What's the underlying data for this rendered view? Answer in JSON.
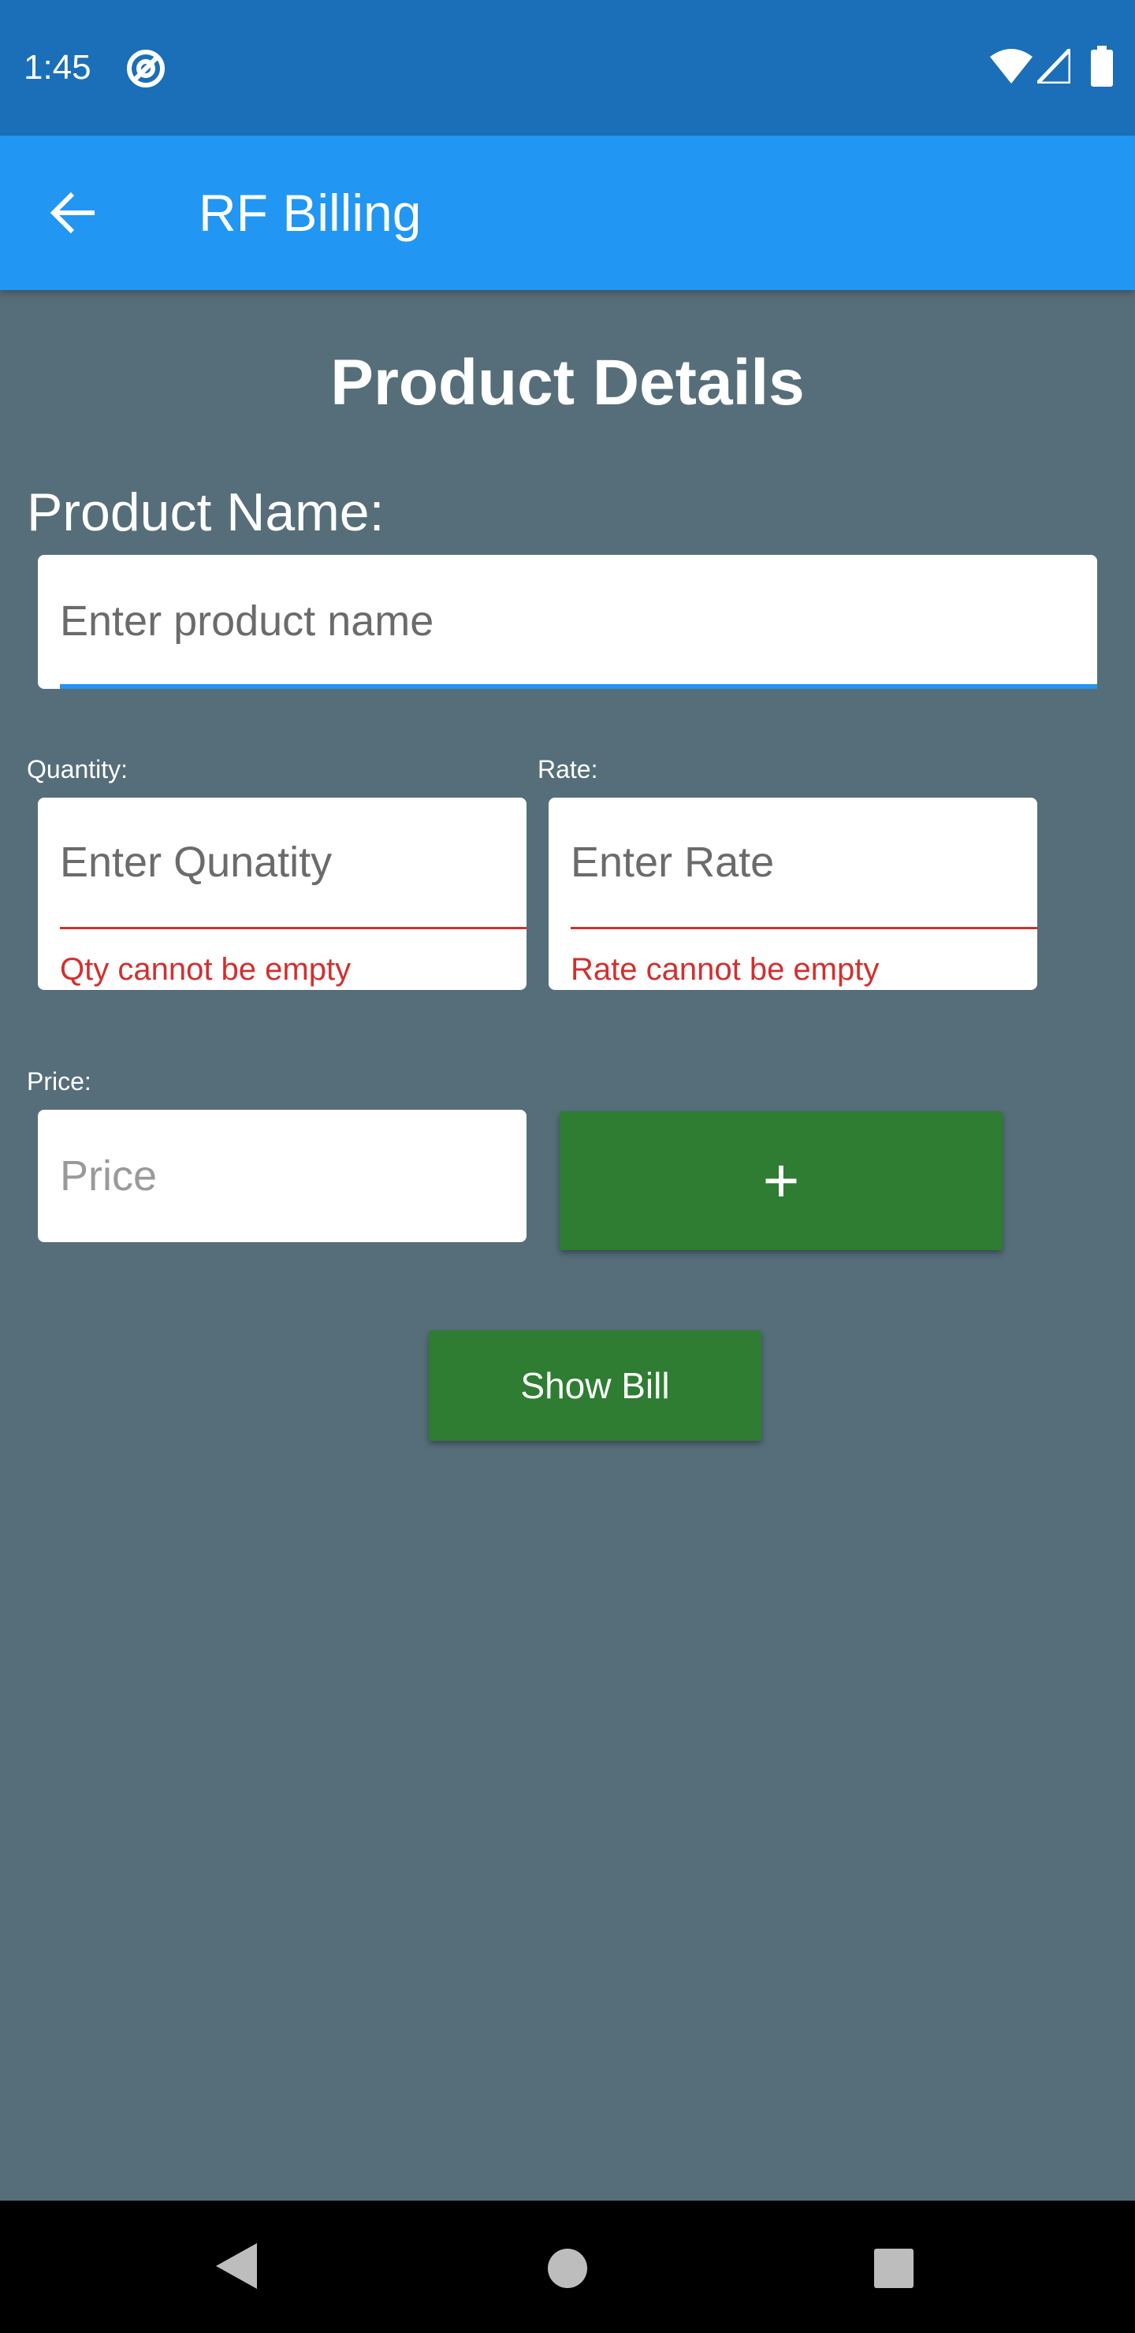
{
  "status_bar": {
    "time": "1:45",
    "icons": [
      "at-sign-icon",
      "wifi-icon",
      "signal-icon",
      "battery-icon"
    ]
  },
  "app_bar": {
    "title": "RF Billing",
    "back_icon": "arrow-left-icon",
    "color": "#2196f3"
  },
  "main": {
    "title": "Product Details",
    "product_name": {
      "label": "Product Name:",
      "placeholder": "Enter product name"
    },
    "quantity": {
      "label": "Quantity:",
      "placeholder": "Enter Qunatity",
      "error": "Qty cannot be empty"
    },
    "rate": {
      "label": "Rate:",
      "placeholder": "Enter Rate",
      "error": "Rate cannot be empty"
    },
    "price": {
      "label": "Price:",
      "placeholder": "Price"
    },
    "add_button": {
      "label": "+"
    },
    "show_bill_button": {
      "label": "Show Bill"
    }
  },
  "nav_bar": {
    "icons": [
      "nav-back-icon",
      "nav-home-icon",
      "nav-recents-icon"
    ]
  },
  "colors": {
    "background": "#566e7a",
    "status_bar": "#1a6fb8",
    "button": "#2e7d32",
    "error": "#d32f2f",
    "focus_underline": "#2196f3"
  }
}
